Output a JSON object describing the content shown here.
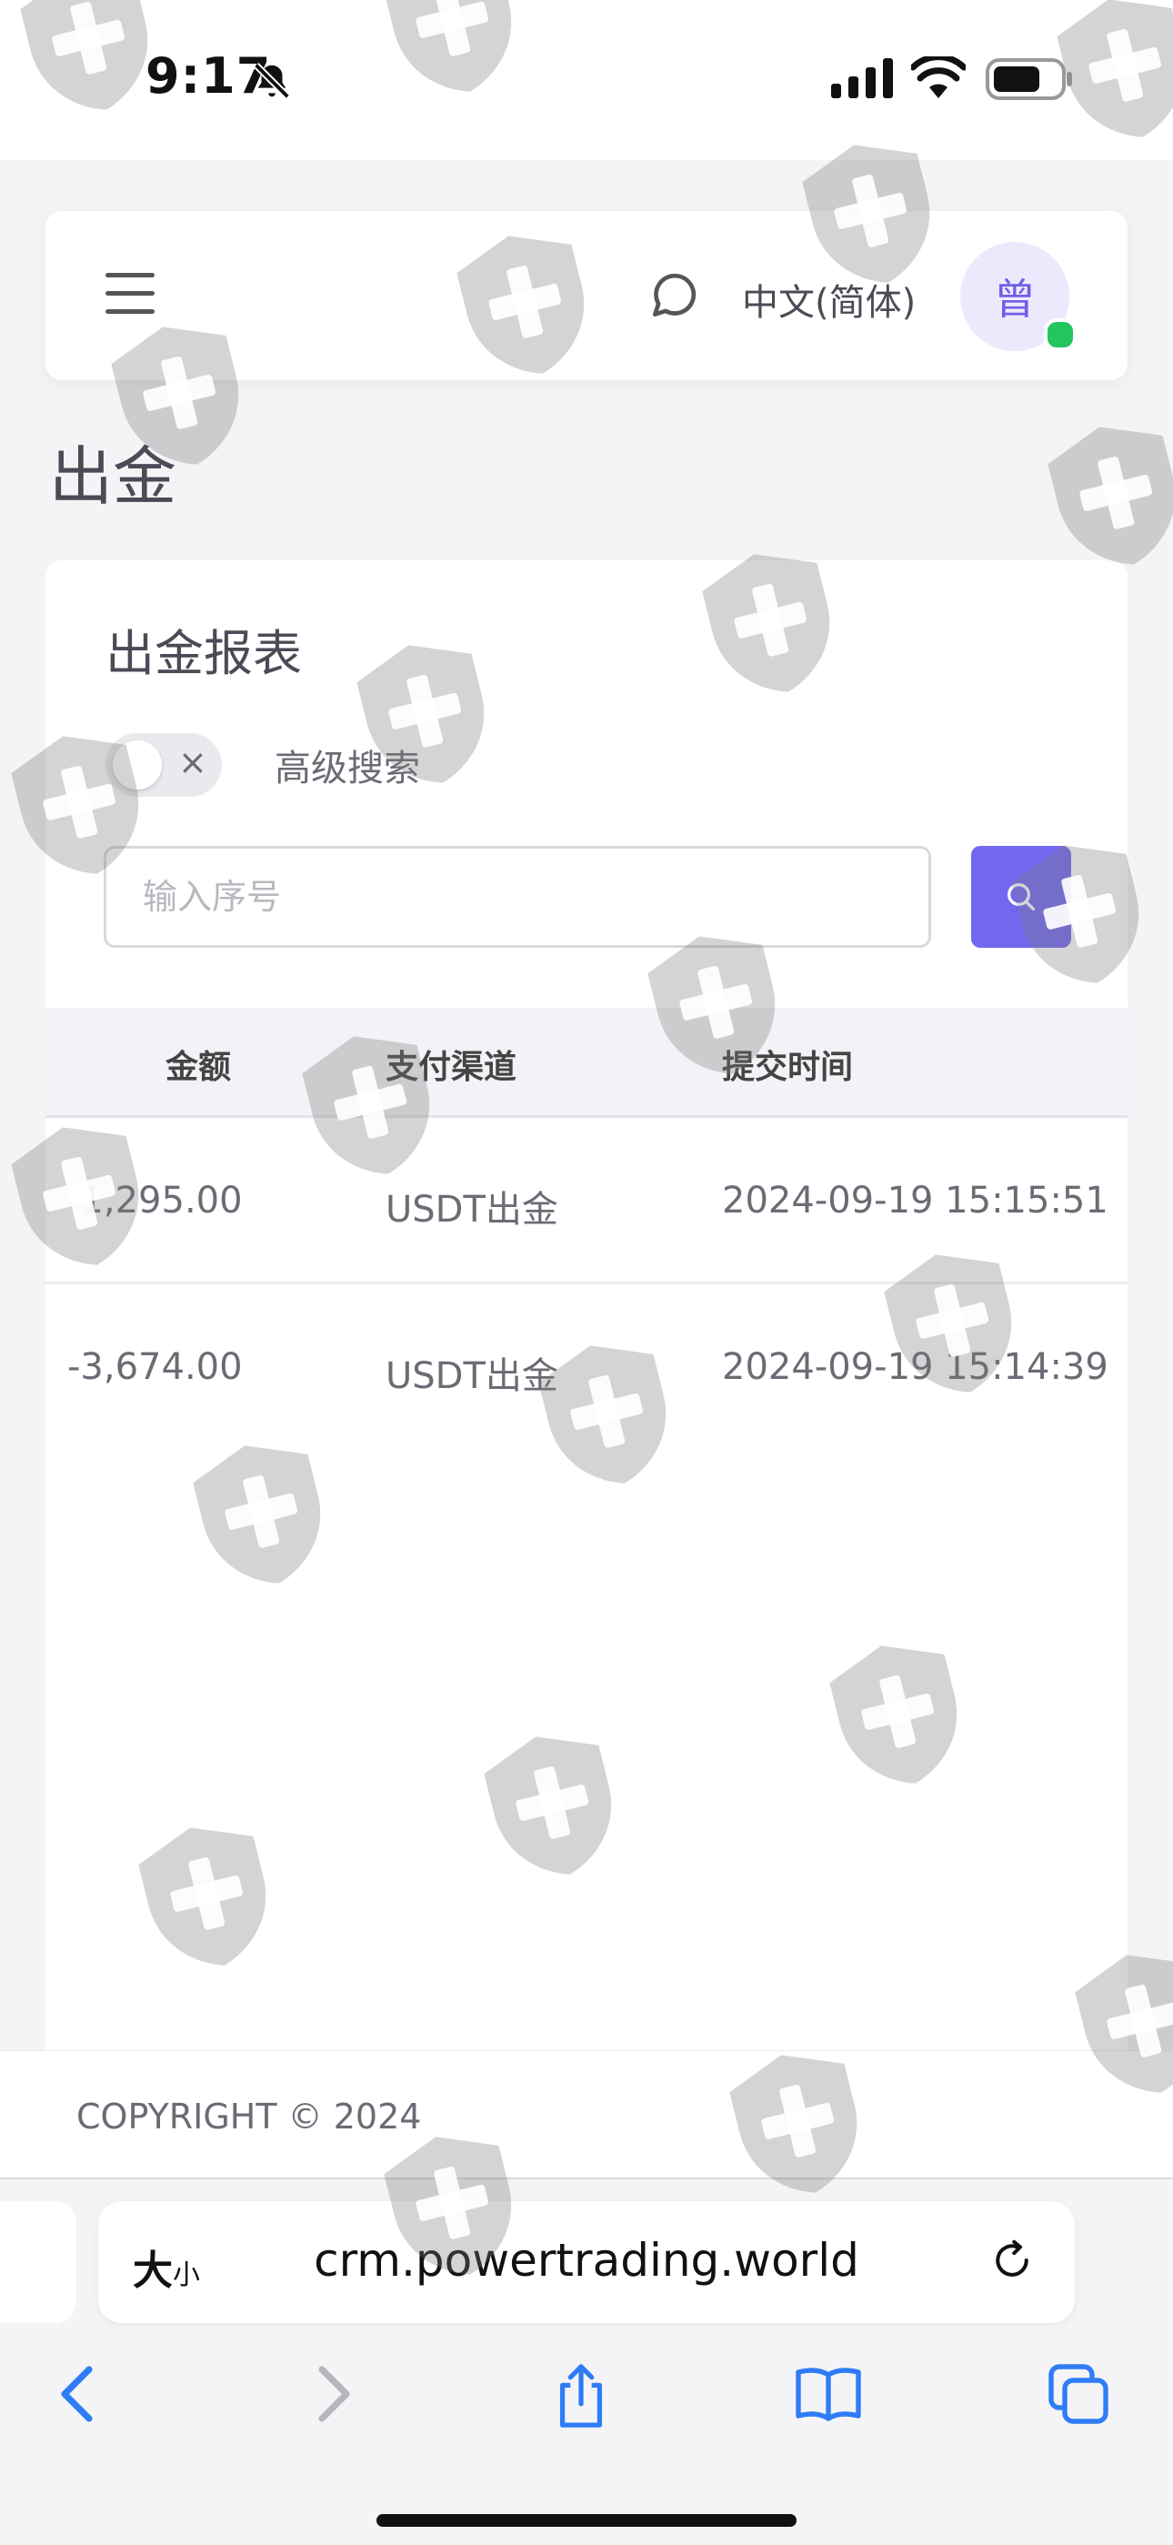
{
  "status_bar": {
    "time": "9:17"
  },
  "navbar": {
    "language": "中文(简体)",
    "avatar_initial": "曾"
  },
  "page": {
    "title": "出金"
  },
  "report": {
    "title": "出金报表",
    "advanced_search_label": "高级搜索",
    "toggle_symbol": "×",
    "search_placeholder": "输入序号",
    "columns": [
      "金额",
      "支付渠道",
      "提交时间"
    ],
    "rows": [
      {
        "amount": "-1,295.00",
        "channel": "USDT出金",
        "time": "2024-09-19 15:15:51"
      },
      {
        "amount": "-3,674.00",
        "channel": "USDT出金",
        "time": "2024-09-19 15:14:39"
      }
    ]
  },
  "footer": {
    "copyright": "COPYRIGHT © 2024"
  },
  "browser": {
    "text_size_label": "大",
    "text_size_small": "小",
    "url": "crm.powertrading.world"
  },
  "colors": {
    "accent": "#7367f0",
    "online": "#22c55e"
  },
  "icons": [
    "bell-slash-icon",
    "signal-icon",
    "wifi-icon",
    "battery-icon",
    "menu-icon",
    "chat-icon",
    "search-icon",
    "reload-icon",
    "back-icon",
    "forward-icon",
    "share-icon",
    "bookmarks-icon",
    "tabs-icon"
  ]
}
